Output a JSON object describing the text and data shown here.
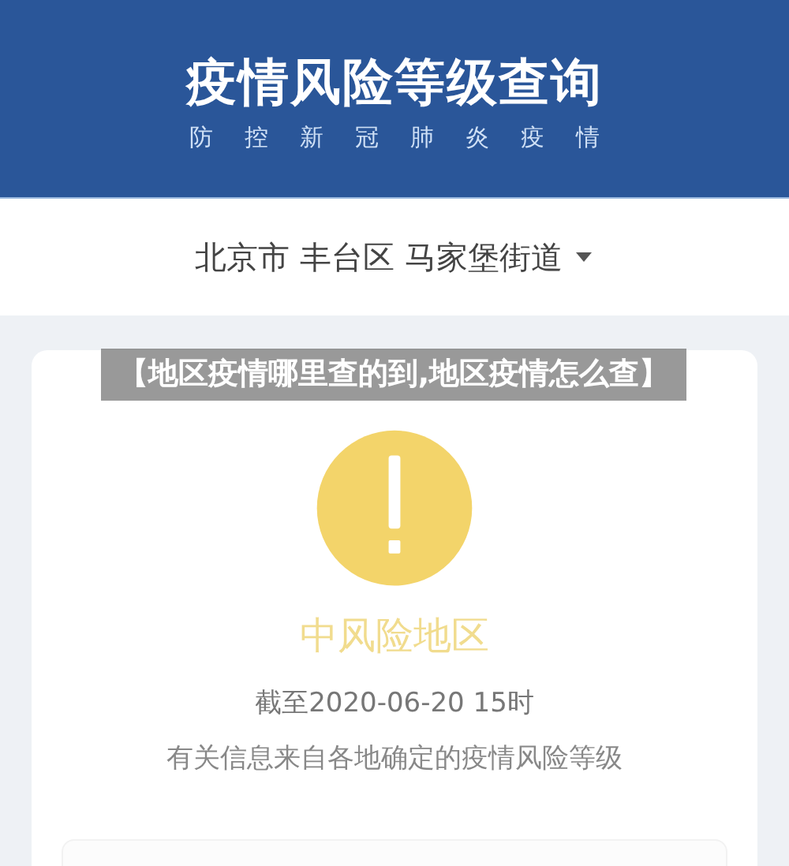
{
  "header": {
    "title": "疫情风险等级查询",
    "subtitle": [
      "防",
      "控",
      "新",
      "冠",
      "肺",
      "炎",
      "疫",
      "情"
    ]
  },
  "location": {
    "value": "北京市 丰台区 马家堡街道"
  },
  "result": {
    "kind": "medium",
    "label": "中风险地区",
    "as_of": "截至2020-06-20 15时",
    "note": "有关信息来自各地确定的疫情风险等级"
  },
  "caption_overlay": {
    "text": "【地区疫情哪里查的到,地区疫情怎么查】"
  }
}
